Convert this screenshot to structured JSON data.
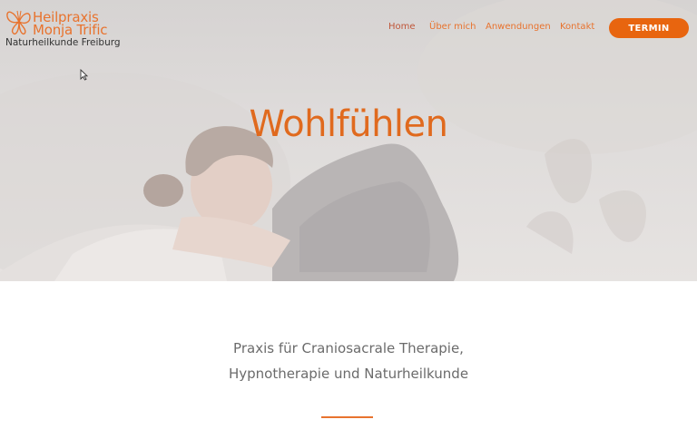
{
  "brand": {
    "name_line1": "Heilpraxis",
    "name_line2": "Monja Trific",
    "tagline": "Naturheilkunde Freiburg",
    "logo_icon": "butterfly-icon",
    "accent_color": "#e8732e"
  },
  "nav": {
    "items": [
      {
        "label": "Home",
        "active": true
      },
      {
        "label": "Über mich",
        "active": false
      },
      {
        "label": "Anwendungen",
        "active": false
      },
      {
        "label": "Kontakt",
        "active": false
      }
    ],
    "cta_label": "TERMIN",
    "cta_color": "#e8650f"
  },
  "hero": {
    "title": "Wohlfühlen"
  },
  "intro": {
    "line1": "Praxis für Craniosacrale Therapie,",
    "line2": "Hypnotherapie und Naturheilkunde"
  },
  "cursor_icon": "mouse-pointer-icon"
}
